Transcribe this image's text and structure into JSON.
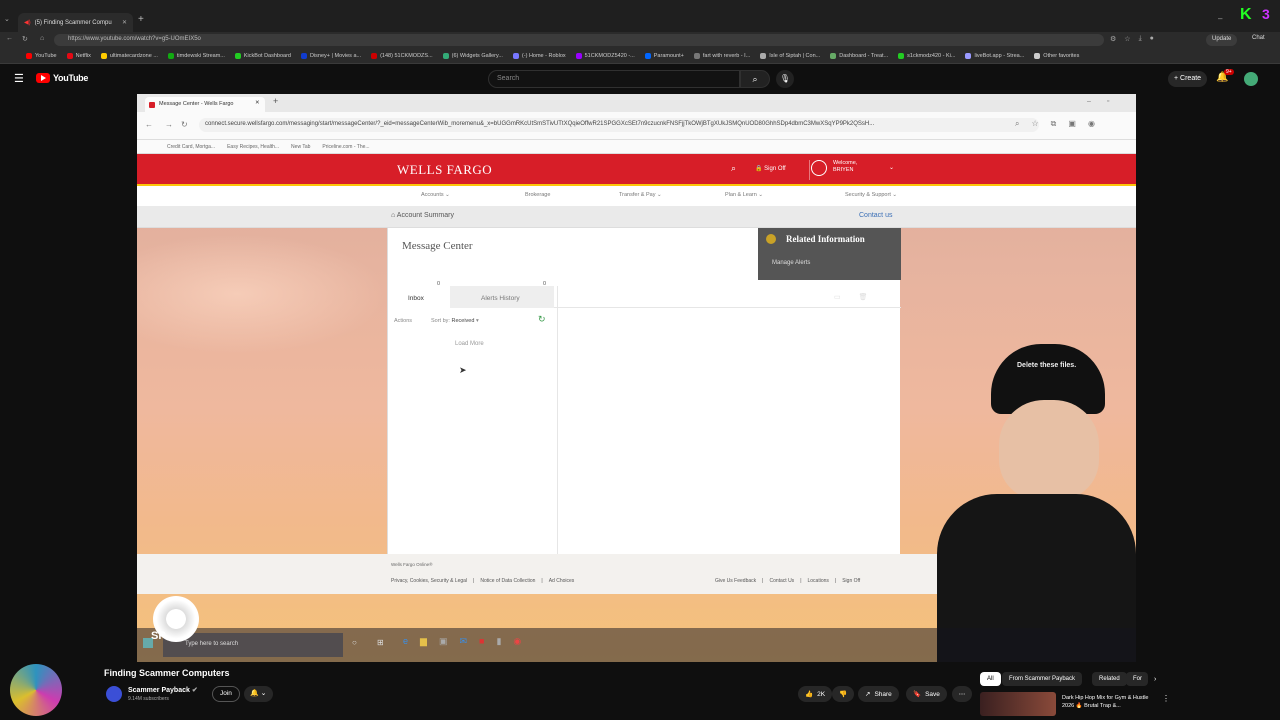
{
  "outer_browser": {
    "active_tab": "(5) Finding Scammer Compu",
    "url": "https://www.youtube.com/watch?v=g5-UOmEIX5o",
    "bookmarks": [
      "YouTube",
      "Netflix",
      "ultimatecardzone ...",
      "timdewski Stream...",
      "KickBot Dashboard",
      "Disney+ | Movies a...",
      "(148) 51CKMODZS...",
      "(6) Widgets Gallery...",
      "(-) Home - Roblox",
      "51CKMODZ5420 -...",
      "Paramount+",
      "fart with reverb - I...",
      "Isle of Siptah | Con...",
      "Dashboard - Treat...",
      "s1ckmodz420 - Ki...",
      "liveBot.app - Strea...",
      "Other favorites"
    ],
    "update_label": "Update",
    "chat_label": "Chat"
  },
  "youtube": {
    "logo_text": "YouTube",
    "search_placeholder": "Search",
    "create_label": "Create",
    "notif_count": "9+",
    "video_title": "Finding Scammer Computers",
    "channel_name": "Scammer Payback",
    "subscribers": "9.14M subscribers",
    "join_label": "Join",
    "likes": "2K",
    "share_label": "Share",
    "save_label": "Save",
    "chips": [
      "All",
      "From Scammer Payback",
      "Related",
      "For"
    ],
    "rec_title": "Dark Hip Hop Mix for Gym & Hustle 2026 🔥 Brutal Trap &..."
  },
  "remote": {
    "tab_title": "Message Center - Wells Fargo",
    "url": "connect.secure.wellsfargo.com/messaging/start/messageCenter/?_eid=messageCenterWib_moremenu&_x=bUGGmRKcUtSmSTivUTtXQqieOffwR21SPGGXcSEt7n9czucnkFNSFjjTkOWjBTgXUkJSMQnUOD80GhhSDp4dbmC3MwXSqYP9Pk2QSsH...",
    "bookmarks": [
      "Credit Card, Mortga...",
      "Easy Recipes, Health...",
      "New Tab",
      "Priceline.com - The..."
    ],
    "brand": "WELLS FARGO",
    "sign_off": "Sign Off",
    "welcome": "Welcome,",
    "user": "BRIYEN",
    "nav": [
      "Accounts",
      "Brokerage",
      "Transfer & Pay",
      "Plan & Learn",
      "Security & Support"
    ],
    "breadcrumb": "Account Summary",
    "contact": "Contact us",
    "page_title": "Message Center",
    "related_title": "Related Information",
    "manage_alerts": "Manage Alerts",
    "tabs": [
      {
        "label": "Inbox",
        "count": "0"
      },
      {
        "label": "Alerts History",
        "count": "0"
      }
    ],
    "actions_label": "Actions",
    "sort_label": "Sort by:",
    "sort_value": "Received",
    "load_more": "Load More",
    "footer_brand": "Wells Fargo Online®",
    "footer_left": [
      "Privacy, Cookies, Security & Legal",
      "Notice of Data Collection",
      "Ad Choices"
    ],
    "footer_right": [
      "Give Us Feedback",
      "Contact Us",
      "Locations",
      "Sign Off"
    ],
    "taskbar_search": "Type here to search",
    "cap_text": "Delete these files."
  },
  "colors": {
    "wf_red": "#d71e28",
    "wf_gold": "#fcc60a",
    "yt_red": "#ff0000"
  }
}
